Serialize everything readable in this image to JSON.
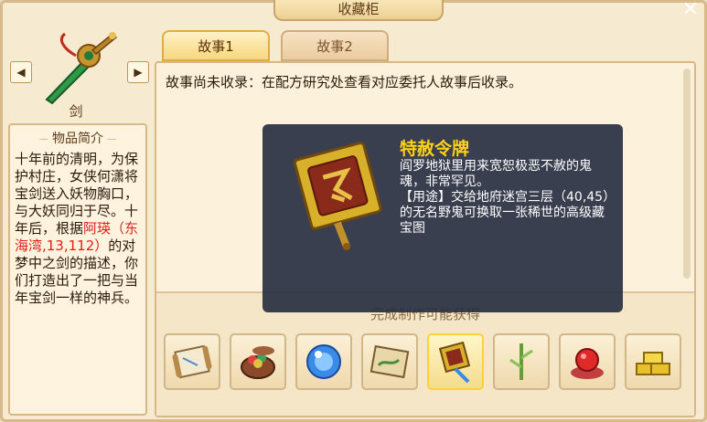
{
  "window": {
    "title": "收藏柜",
    "close_glyph": "✕"
  },
  "item": {
    "prev_glyph": "◀",
    "next_glyph": "▶",
    "name": "剑",
    "icon": "green-jade-sword-icon"
  },
  "intro": {
    "title": "物品简介",
    "text_before": "十年前的清明，为保护村庄，女侠何潇将宝剑送入妖物胸口，与大妖同归于尽。十年后，根据",
    "highlight": "阿瑛（东海湾,13,112）",
    "text_after": "的对梦中之剑的描述，你们打造出了一把与当年宝剑一样的神兵。"
  },
  "tabs": [
    {
      "label": "故事1"
    },
    {
      "label": "故事2"
    }
  ],
  "story": {
    "text": "故事尚未收录：在配方研究处查看对应委托人故事后收录。"
  },
  "rewards": {
    "title": "完成制作可能获得",
    "items": [
      {
        "name": "map-scroll-icon"
      },
      {
        "name": "treasure-bowl-icon"
      },
      {
        "name": "blue-orb-icon"
      },
      {
        "name": "treasure-map-icon"
      },
      {
        "name": "pardon-token-icon",
        "selected": true
      },
      {
        "name": "bamboo-icon"
      },
      {
        "name": "red-pearl-icon"
      },
      {
        "name": "gold-bars-icon"
      }
    ]
  },
  "tooltip": {
    "name": "特赦令牌",
    "desc_line1": "阎罗地狱里用来宽恕极恶不赦的鬼魂，非常罕见。",
    "desc_line2": "【用途】交给地府迷宫三层（40,45）的无名野鬼可换取一张稀世的高级藏宝图"
  },
  "colors": {
    "accent_gold": "#ffd11a",
    "highlight_red": "#e02018",
    "panel_bg": "#f6ead0"
  }
}
